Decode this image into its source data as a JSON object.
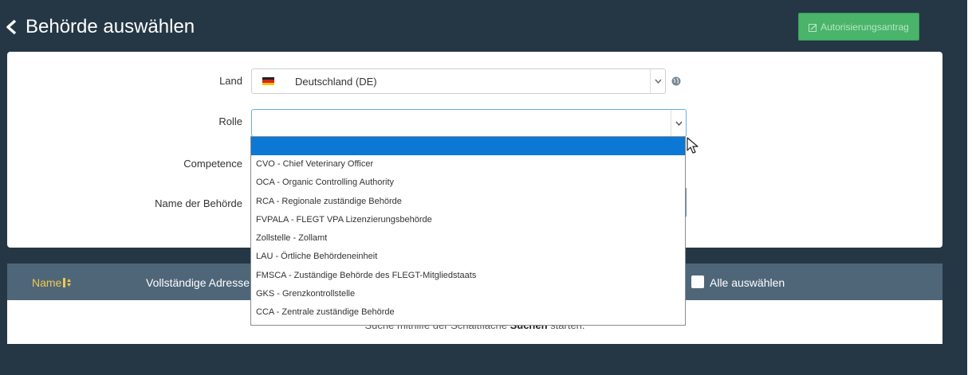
{
  "header": {
    "title": "Behörde auswählen",
    "authorization_button_label": "Autorisierungsantrag"
  },
  "form": {
    "land_label": "Land",
    "land_value": "Deutschland (DE)",
    "rolle_label": "Rolle",
    "rolle_value": "",
    "competence_label": "Competence",
    "authority_name_label": "Name der Behörde"
  },
  "rolle_dropdown": {
    "options": [
      "",
      "CVO - Chief Veterinary Officer",
      "OCA - Organic Controlling Authority",
      "RCA - Regionale zuständige Behörde",
      "FVPALA - FLEGT VPA Lizenzierungsbehörde",
      "Zollstelle - Zollamt",
      "LAU - Örtliche Behördeneinheit",
      "FMSCA - Zuständige Behörde des FLEGT-Mitgliedstaats",
      "GKS - Grenzkontrollstelle",
      "CCA - Zentrale zuständige Behörde"
    ],
    "highlighted_index": 0
  },
  "table": {
    "columns": {
      "name": "Name",
      "address": "Vollständige Adresse",
      "select_all": "Alle auswählen"
    },
    "empty_message_prefix": "Suche mithilfe der Schaltfläche",
    "empty_message_bold": "Suchen",
    "empty_message_suffix": "starten."
  },
  "colors": {
    "background": "#253745",
    "table_header": "#4f6679",
    "accent_green": "#49b46a",
    "highlight_blue": "#0a78d4",
    "sort_column": "#f0c84f"
  },
  "icons": [
    "back-chevron-icon",
    "document-edit-icon",
    "germany-flag-icon",
    "globe-icon",
    "chevron-down-icon",
    "sort-icon",
    "mouse-pointer-icon"
  ]
}
